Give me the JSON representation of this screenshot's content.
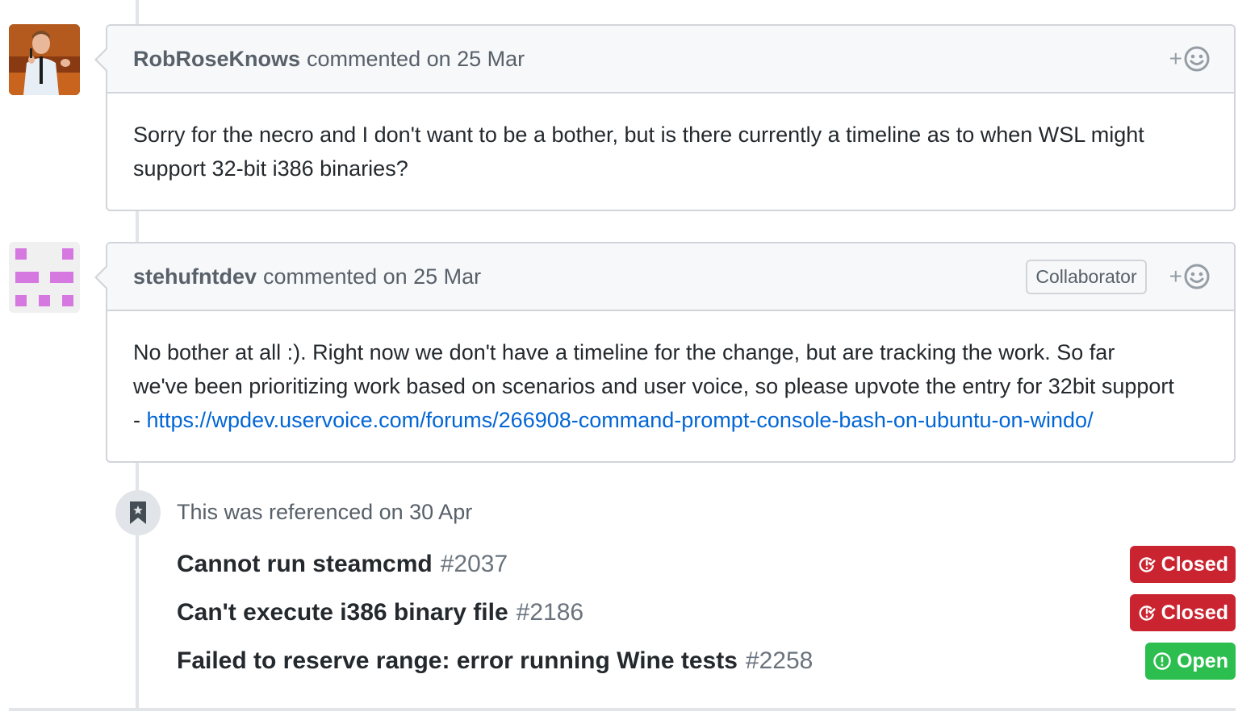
{
  "comments": [
    {
      "author": "RobRoseKnows",
      "action": "commented on 25 Mar",
      "role": "",
      "body": "Sorry for the necro and I don't want to be a bother, but is there currently a timeline as to when WSL might support 32-bit i386 binaries?"
    },
    {
      "author": "stehufntdev",
      "action": "commented on 25 Mar",
      "role": "Collaborator",
      "body_line1": "No bother at all :). Right now we don't have a timeline for the change, but are tracking the work. So far",
      "body_line2": "we've been prioritizing work based on scenarios and user voice, so please upvote the entry for 32bit support",
      "body_prefix": "- ",
      "link": "https://wpdev.uservoice.com/forums/266908-command-prompt-console-bash-on-ubuntu-on-windo/"
    }
  ],
  "reactions": {
    "add_label": "+"
  },
  "references": {
    "title": "This was referenced on 30 Apr",
    "items": [
      {
        "title": "Cannot run steamcmd",
        "number": "#2037",
        "state": "Closed",
        "state_color": "#cb2431"
      },
      {
        "title": "Can't execute i386 binary file",
        "number": "#2186",
        "state": "Closed",
        "state_color": "#cb2431"
      },
      {
        "title": "Failed to reserve range: error running Wine tests",
        "number": "#2258",
        "state": "Open",
        "state_color": "#2cbe4e"
      }
    ]
  }
}
